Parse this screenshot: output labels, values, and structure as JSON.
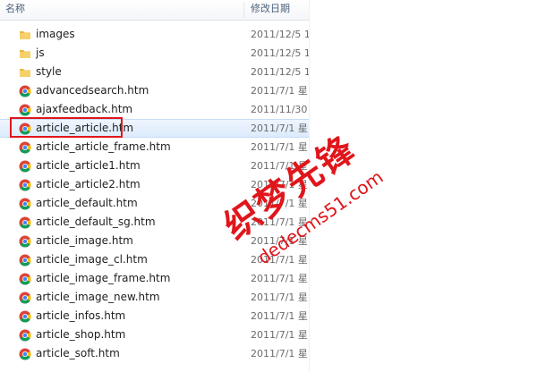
{
  "header": {
    "name_label": "名称",
    "date_label": "修改日期"
  },
  "files": [
    {
      "name": "images",
      "date": "2011/12/5 1",
      "icon": "folder-icon"
    },
    {
      "name": "js",
      "date": "2011/12/5 1",
      "icon": "folder-icon"
    },
    {
      "name": "style",
      "date": "2011/12/5 1",
      "icon": "folder-icon"
    },
    {
      "name": "advancedsearch.htm",
      "date": "2011/7/1 星",
      "icon": "chrome-icon"
    },
    {
      "name": "ajaxfeedback.htm",
      "date": "2011/11/30",
      "icon": "chrome-icon"
    },
    {
      "name": "article_article.htm",
      "date": "2011/7/1 星",
      "icon": "chrome-icon",
      "selected": true
    },
    {
      "name": "article_article_frame.htm",
      "date": "2011/7/1 星",
      "icon": "chrome-icon"
    },
    {
      "name": "article_article1.htm",
      "date": "2011/7/1 星",
      "icon": "chrome-icon"
    },
    {
      "name": "article_article2.htm",
      "date": "2011/7/1 星",
      "icon": "chrome-icon"
    },
    {
      "name": "article_default.htm",
      "date": "2011/7/1 星",
      "icon": "chrome-icon"
    },
    {
      "name": "article_default_sg.htm",
      "date": "2011/7/1 星",
      "icon": "chrome-icon"
    },
    {
      "name": "article_image.htm",
      "date": "2011/7/1 星",
      "icon": "chrome-icon"
    },
    {
      "name": "article_image_cl.htm",
      "date": "2011/7/1 星",
      "icon": "chrome-icon"
    },
    {
      "name": "article_image_frame.htm",
      "date": "2011/7/1 星",
      "icon": "chrome-icon"
    },
    {
      "name": "article_image_new.htm",
      "date": "2011/7/1 星",
      "icon": "chrome-icon"
    },
    {
      "name": "article_infos.htm",
      "date": "2011/7/1 星",
      "icon": "chrome-icon"
    },
    {
      "name": "article_shop.htm",
      "date": "2011/7/1 星",
      "icon": "chrome-icon"
    },
    {
      "name": "article_soft.htm",
      "date": "2011/7/1 星",
      "icon": "chrome-icon"
    }
  ],
  "watermark": {
    "text_cn": "织梦先锋",
    "text_url": "dedecms51.com",
    "color": "#e0161b"
  },
  "colors": {
    "selection_bg": "#dcebfc",
    "highlight_border": "#e0161b",
    "folder_yellow": "#f2c94c"
  }
}
